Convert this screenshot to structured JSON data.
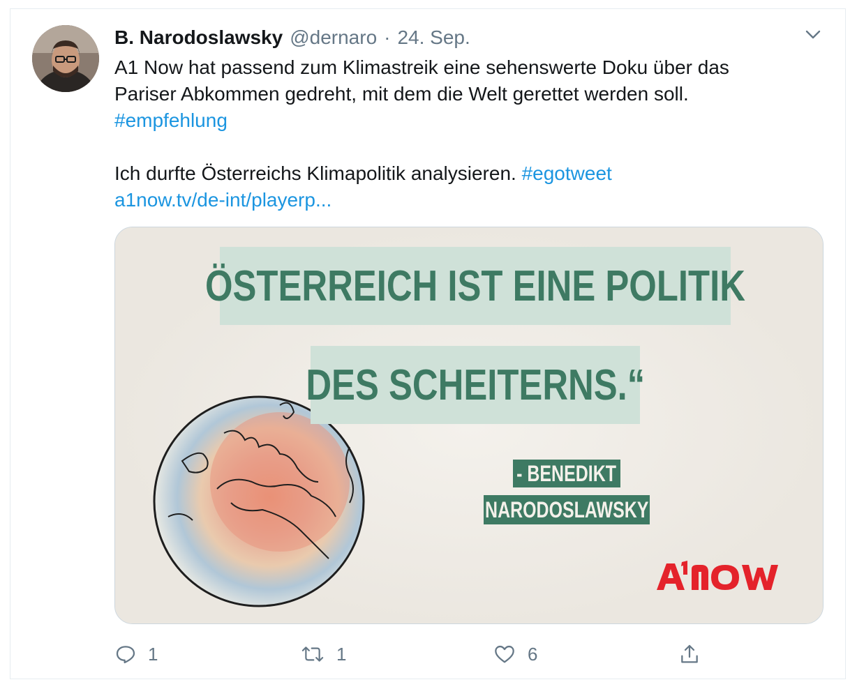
{
  "tweet": {
    "name": "B. Narodoslawsky",
    "handle": "@dernaro",
    "separator": "·",
    "date": "24. Sep.",
    "text_line1": "A1 Now hat passend zum Klimastreik eine sehenswerte Doku über das",
    "text_line2": "Pariser Abkommen gedreht, mit dem die Welt gerettet werden soll.",
    "hashtag1": "#empfehlung",
    "text_line4": "Ich durfte Österreichs Klimapolitik analysieren.",
    "hashtag2": "#egotweet",
    "link": "a1now.tv/de-int/playerp..."
  },
  "card": {
    "quote_line1": "ÖSTERREICH IST EINE POLITIK",
    "quote_line2": "DES SCHEITERNS.“",
    "author_line1": "- BENEDIKT",
    "author_line2": "NARODOSLAWSKY",
    "logo_text": "A1NOW"
  },
  "actions": {
    "reply_count": "1",
    "retweet_count": "1",
    "like_count": "6"
  },
  "icons": {
    "caret": "chevron-down-icon",
    "reply": "reply-icon",
    "retweet": "retweet-icon",
    "like": "heart-icon",
    "share": "share-icon"
  },
  "colors": {
    "link": "#1b95e0",
    "secondary_text": "#657786",
    "quote_green": "#3e7a63",
    "quote_bg": "#cfe1d8",
    "logo_red": "#e4232b"
  }
}
